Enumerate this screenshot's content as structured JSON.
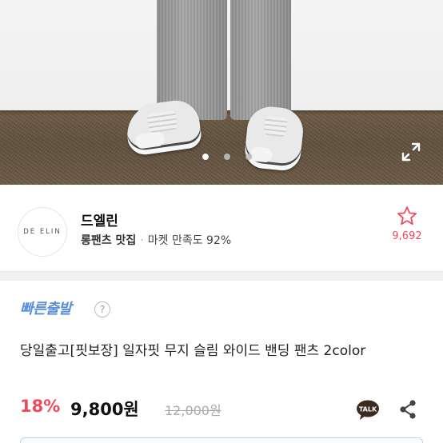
{
  "carousel": {
    "total": 3,
    "active_index": 0
  },
  "shop": {
    "logo_text": "DE ELIN",
    "name": "드엘린",
    "tagline": "롱팬츠 맛집",
    "separator": "·",
    "satisfaction": "마켓 만족도 92%",
    "favorite_count": "9,692"
  },
  "product": {
    "badge": "빠른출발",
    "help": "?",
    "title": "당일출고[핏보장] 일자핏 무지 슬림 와이드 밴딩 팬츠 2color",
    "discount": "18%",
    "price": "9,800원",
    "original_price": "12,000원",
    "talk_label": "TALK"
  },
  "colors": {
    "accent_red": "#f04a5c",
    "badge_blue": "#5b8fdc",
    "talk_yellow": "#fae100"
  }
}
